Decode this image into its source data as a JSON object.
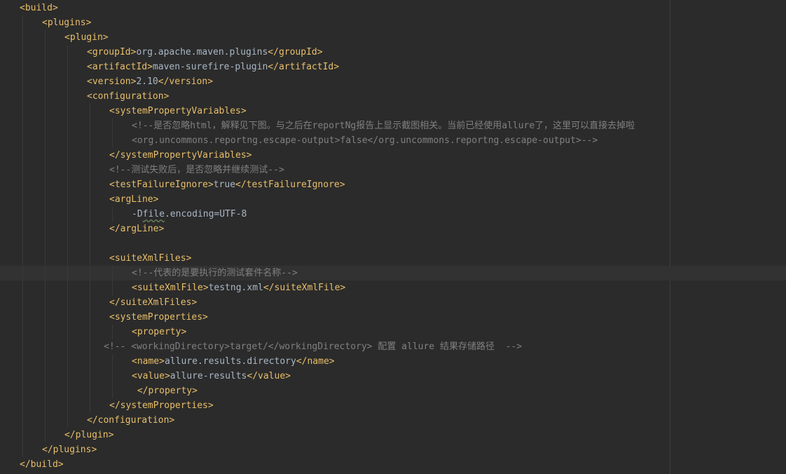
{
  "editor": {
    "language": "xml",
    "current_line_index": 18,
    "colors": {
      "background": "#2b2b2b",
      "tag": "#e8bf6a",
      "text": "#a9b7c6",
      "comment": "#808080",
      "current_line": "#323232"
    },
    "lines": [
      {
        "indent": 0,
        "segments": [
          {
            "t": "tag",
            "v": "<build>"
          }
        ]
      },
      {
        "indent": 1,
        "segments": [
          {
            "t": "tag",
            "v": "<plugins>"
          }
        ]
      },
      {
        "indent": 2,
        "segments": [
          {
            "t": "tag",
            "v": "<plugin>"
          }
        ]
      },
      {
        "indent": 3,
        "segments": [
          {
            "t": "tag",
            "v": "<groupId>"
          },
          {
            "t": "txt",
            "v": "org.apache.maven.plugins"
          },
          {
            "t": "tag",
            "v": "</groupId>"
          }
        ]
      },
      {
        "indent": 3,
        "segments": [
          {
            "t": "tag",
            "v": "<artifactId>"
          },
          {
            "t": "txt",
            "v": "maven-surefire-plugin"
          },
          {
            "t": "tag",
            "v": "</artifactId>"
          }
        ]
      },
      {
        "indent": 3,
        "segments": [
          {
            "t": "tag",
            "v": "<version>"
          },
          {
            "t": "txt",
            "v": "2.10"
          },
          {
            "t": "tag",
            "v": "</version>"
          }
        ]
      },
      {
        "indent": 3,
        "segments": [
          {
            "t": "tag",
            "v": "<configuration>"
          }
        ]
      },
      {
        "indent": 4,
        "segments": [
          {
            "t": "tag",
            "v": "<systemPropertyVariables>"
          }
        ]
      },
      {
        "indent": 5,
        "segments": [
          {
            "t": "cmt",
            "v": "<!--是否忽略html，解释见下图。与之后在reportNg报告上显示截图相关。当前已经使用allure了，这里可以直接去掉啦"
          }
        ]
      },
      {
        "indent": 5,
        "segments": [
          {
            "t": "cmt",
            "v": "<org.uncommons.reportng.escape-output>false</org.uncommons.reportng.escape-output>-->"
          }
        ]
      },
      {
        "indent": 4,
        "segments": [
          {
            "t": "tag",
            "v": "</systemPropertyVariables>"
          }
        ]
      },
      {
        "indent": 4,
        "segments": [
          {
            "t": "cmt",
            "v": "<!--测试失败后，是否忽略并继续测试-->"
          }
        ]
      },
      {
        "indent": 4,
        "segments": [
          {
            "t": "tag",
            "v": "<testFailureIgnore>"
          },
          {
            "t": "txt",
            "v": "true"
          },
          {
            "t": "tag",
            "v": "</testFailureIgnore>"
          }
        ]
      },
      {
        "indent": 4,
        "segments": [
          {
            "t": "tag",
            "v": "<argLine>"
          }
        ]
      },
      {
        "indent": 5,
        "segments": [
          {
            "t": "txt",
            "v": "-D"
          },
          {
            "t": "sq",
            "v": "file"
          },
          {
            "t": "txt",
            "v": ".encoding=UTF-8"
          }
        ]
      },
      {
        "indent": 4,
        "segments": [
          {
            "t": "tag",
            "v": "</argLine>"
          }
        ]
      },
      {
        "indent": 4,
        "segments": []
      },
      {
        "indent": 4,
        "segments": [
          {
            "t": "tag",
            "v": "<suiteXmlFiles>"
          }
        ]
      },
      {
        "indent": 5,
        "segments": [
          {
            "t": "cmt",
            "v": "<!--代表的是要执行的测试套件名称-->"
          }
        ]
      },
      {
        "indent": 5,
        "segments": [
          {
            "t": "tag",
            "v": "<suiteXmlFile>"
          },
          {
            "t": "txt",
            "v": "testng.xml"
          },
          {
            "t": "tag",
            "v": "</suiteXmlFile>"
          }
        ]
      },
      {
        "indent": 4,
        "segments": [
          {
            "t": "tag",
            "v": "</suiteXmlFiles>"
          }
        ]
      },
      {
        "indent": 4,
        "segments": [
          {
            "t": "tag",
            "v": "<systemProperties>"
          }
        ]
      },
      {
        "indent": 5,
        "segments": [
          {
            "t": "tag",
            "v": "<property>"
          }
        ]
      },
      {
        "indent": 4,
        "segments": [
          {
            "t": "cmt",
            "v": "<!-- <workingDirectory>target/</workingDirectory> 配置 allure 结果存储路径  -->"
          }
        ]
      },
      {
        "indent": 5,
        "segments": [
          {
            "t": "tag",
            "v": "<name>"
          },
          {
            "t": "txt",
            "v": "allure.results.directory"
          },
          {
            "t": "tag",
            "v": "</name>"
          }
        ]
      },
      {
        "indent": 5,
        "segments": [
          {
            "t": "tag",
            "v": "<value>"
          },
          {
            "t": "txt",
            "v": "allure-results"
          },
          {
            "t": "tag",
            "v": "</value>"
          }
        ]
      },
      {
        "indent": 5,
        "segments": [
          {
            "t": "tag",
            "v": " </property>"
          }
        ]
      },
      {
        "indent": 4,
        "segments": [
          {
            "t": "tag",
            "v": "</systemProperties>"
          }
        ]
      },
      {
        "indent": 3,
        "segments": [
          {
            "t": "tag",
            "v": "</configuration>"
          }
        ]
      },
      {
        "indent": 2,
        "segments": [
          {
            "t": "tag",
            "v": "</plugin>"
          }
        ]
      },
      {
        "indent": 1,
        "segments": [
          {
            "t": "tag",
            "v": "</plugins>"
          }
        ]
      },
      {
        "indent": 0,
        "segments": [
          {
            "t": "tag",
            "v": "</build>"
          }
        ]
      }
    ]
  }
}
